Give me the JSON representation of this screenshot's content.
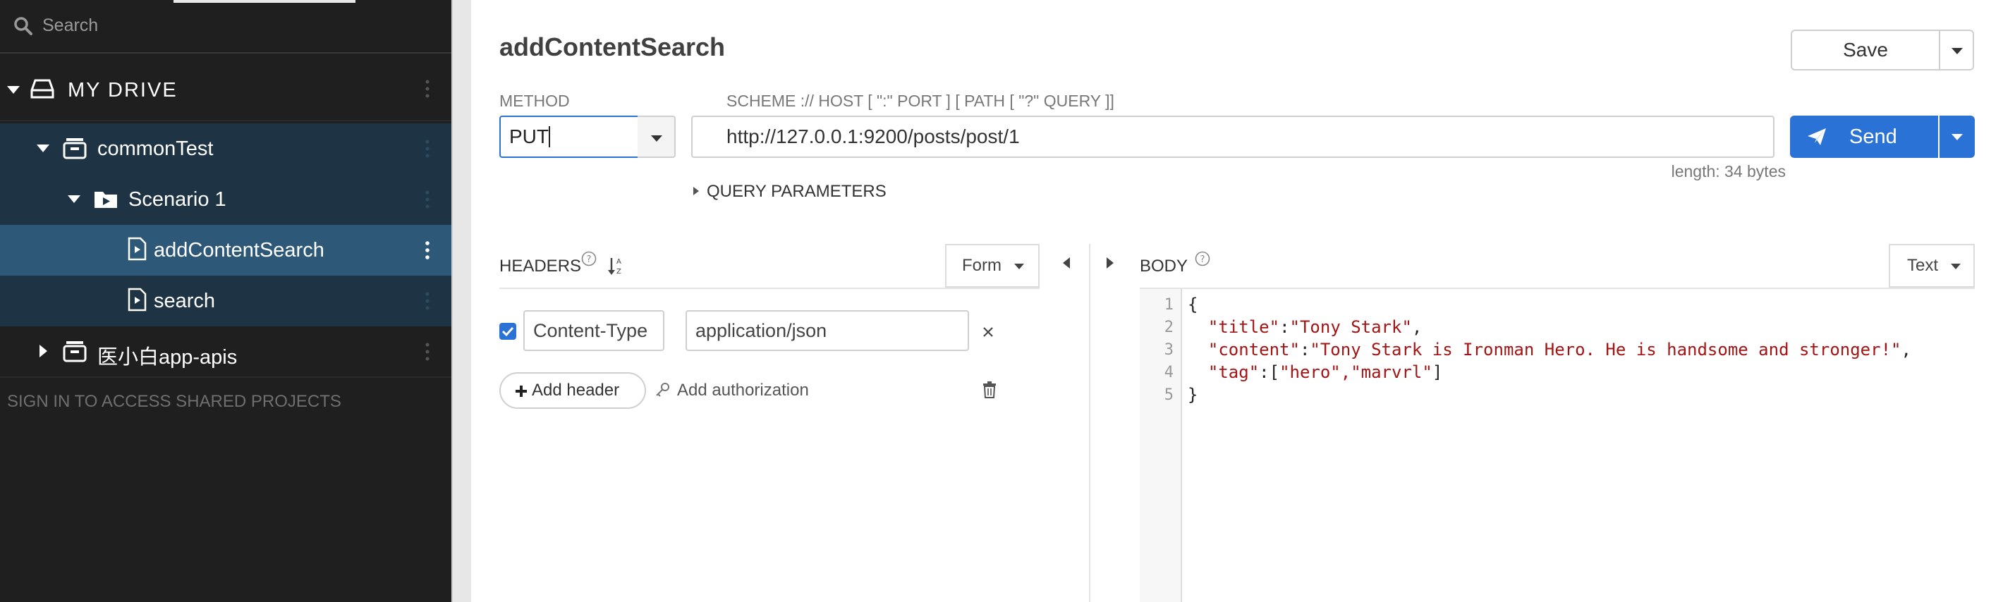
{
  "sidebar": {
    "search_placeholder": "Search",
    "drive_label": "MY DRIVE",
    "items": [
      {
        "label": "commonTest"
      },
      {
        "label": "Scenario 1"
      },
      {
        "label": "addContentSearch"
      },
      {
        "label": "search"
      },
      {
        "label": "医小白app-apis"
      }
    ],
    "sign_in": "SIGN IN TO ACCESS SHARED PROJECTS"
  },
  "request": {
    "title": "addContentSearch",
    "save_label": "Save",
    "method_label": "METHOD",
    "method_value": "PUT",
    "url_label": "SCHEME :// HOST [ \":\" PORT ] [ PATH [ \"?\" QUERY ]]",
    "url_value": "http://127.0.0.1:9200/posts/post/1",
    "send_label": "Send",
    "length_text": "length: 34 bytes",
    "query_params_label": "QUERY PARAMETERS"
  },
  "headers": {
    "title": "HEADERS",
    "form_label": "Form",
    "rows": [
      {
        "key": "Content-Type",
        "value": "application/json",
        "enabled": true
      }
    ],
    "add_header_label": "Add header",
    "add_auth_label": "Add authorization"
  },
  "body": {
    "title": "BODY",
    "text_label": "Text",
    "line_numbers": [
      "1",
      "2",
      "3",
      "4",
      "5"
    ],
    "lines": [
      {
        "pre": "{",
        "k": "",
        "mid": "",
        "v": "",
        "post": ""
      },
      {
        "pre": "  ",
        "k": "\"title\"",
        "mid": ":",
        "v": "\"Tony Stark\"",
        "post": ","
      },
      {
        "pre": "  ",
        "k": "\"content\"",
        "mid": ":",
        "v": "\"Tony Stark is Ironman Hero. He is handsome and stronger!\"",
        "post": ","
      },
      {
        "pre": "  ",
        "k": "\"tag\"",
        "mid": ":[",
        "v": "\"hero\",\"marvrl\"",
        "post": "]"
      },
      {
        "pre": "}",
        "k": "",
        "mid": "",
        "v": "",
        "post": ""
      }
    ]
  },
  "colors": {
    "sidebar_bg": "#1f1f1f",
    "selected_row": "#2d5878",
    "nested_row": "#1e3444",
    "accent_blue": "#2a72d5",
    "string_red": "#a31515"
  }
}
